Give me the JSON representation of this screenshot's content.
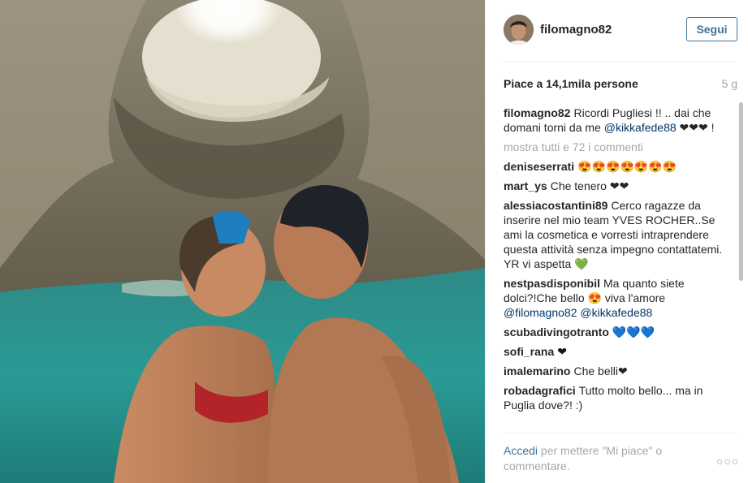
{
  "post": {
    "username": "filomagno82",
    "follow_label": "Segui",
    "likes_text": "Piace a 14,1mila persone",
    "time_ago": "5 g"
  },
  "caption": {
    "author": "filomagno82",
    "text_before": "Ricordi Pugliesi !! .. dai che domani torni da me ",
    "mention": "@kikkafede88",
    "text_after": " ❤❤❤ !"
  },
  "more_comments_label": "mostra tutti e 72 i commenti",
  "comments": [
    {
      "author": "deniseserrati",
      "text": "😍😍😍😍😍😍😍"
    },
    {
      "author": "mart_ys",
      "text": "Che tenero ❤❤"
    },
    {
      "author": "alessiacostantini89",
      "text": "Cerco ragazze da inserire nel mio team YVES ROCHER..Se ami la cosmetica e vorresti intraprendere questa attività senza impegno contattatemi. YR vi aspetta 💚"
    },
    {
      "author": "nestpasdisponibil",
      "text": "Ma quanto siete dolci?!Che bello 😍 viva l'amore",
      "mentions": "@filomagno82 @kikkafede88"
    },
    {
      "author": "scubadivingotranto",
      "text": "💙💙💙"
    },
    {
      "author": "sofi_rana",
      "text": "❤"
    },
    {
      "author": "imalemarino",
      "text": "Che belli❤"
    },
    {
      "author": "robadagrafici",
      "text": "Tutto molto bello... ma in Puglia dove?! :)"
    }
  ],
  "footer": {
    "login_link": "Accedi",
    "login_text": " per mettere \"Mi piace\" o commentare.",
    "options_label": "○○○"
  },
  "colors": {
    "link": "#3f729b",
    "mention": "#003569",
    "muted": "#a5a7aa"
  },
  "icons": {
    "options": "more-options-icon",
    "avatar": "user-avatar"
  }
}
